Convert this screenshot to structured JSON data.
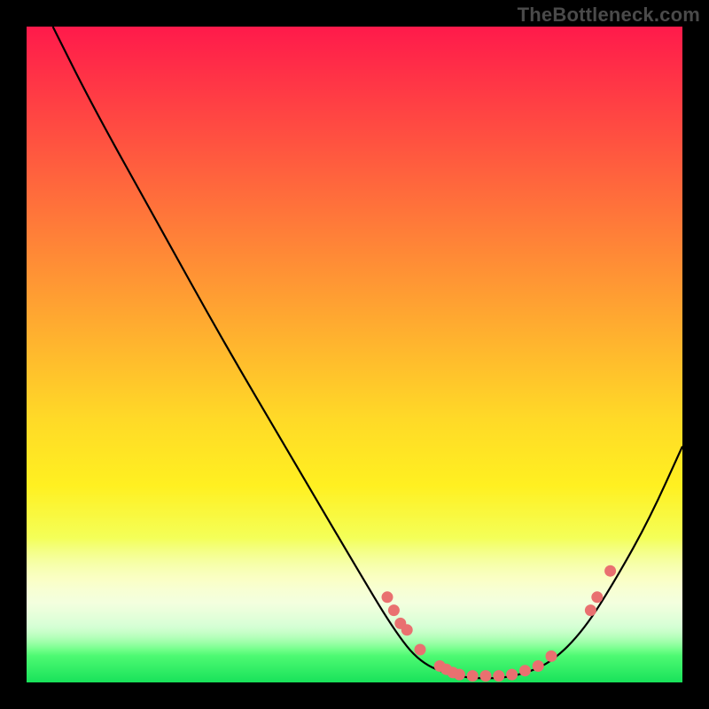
{
  "watermark": "TheBottleneck.com",
  "colors": {
    "background": "#000000",
    "gradient_top": "#ff1a4b",
    "gradient_mid": "#ffda27",
    "gradient_bottom": "#18e25a",
    "curve_stroke": "#000000",
    "dot_fill": "#e97070"
  },
  "chart_data": {
    "type": "line",
    "title": "",
    "xlabel": "",
    "ylabel": "",
    "xlim": [
      0,
      100
    ],
    "ylim": [
      0,
      100
    ],
    "note": "Axes are unlabeled; values are percent estimates along each axis read from pixel positions.",
    "series": [
      {
        "name": "bottleneck-curve",
        "points": [
          {
            "x": 4,
            "y": 100
          },
          {
            "x": 10,
            "y": 88
          },
          {
            "x": 20,
            "y": 70
          },
          {
            "x": 30,
            "y": 52
          },
          {
            "x": 40,
            "y": 35
          },
          {
            "x": 50,
            "y": 18
          },
          {
            "x": 56,
            "y": 8
          },
          {
            "x": 60,
            "y": 3
          },
          {
            "x": 65,
            "y": 1
          },
          {
            "x": 70,
            "y": 0.5
          },
          {
            "x": 75,
            "y": 1
          },
          {
            "x": 80,
            "y": 3
          },
          {
            "x": 85,
            "y": 8
          },
          {
            "x": 90,
            "y": 16
          },
          {
            "x": 95,
            "y": 25
          },
          {
            "x": 100,
            "y": 36
          }
        ]
      },
      {
        "name": "highlighted-dots",
        "points": [
          {
            "x": 55,
            "y": 13
          },
          {
            "x": 56,
            "y": 11
          },
          {
            "x": 57,
            "y": 9
          },
          {
            "x": 58,
            "y": 8
          },
          {
            "x": 60,
            "y": 5
          },
          {
            "x": 63,
            "y": 2.5
          },
          {
            "x": 64,
            "y": 2
          },
          {
            "x": 65,
            "y": 1.5
          },
          {
            "x": 66,
            "y": 1.2
          },
          {
            "x": 68,
            "y": 1
          },
          {
            "x": 70,
            "y": 1
          },
          {
            "x": 72,
            "y": 1
          },
          {
            "x": 74,
            "y": 1.2
          },
          {
            "x": 76,
            "y": 1.8
          },
          {
            "x": 78,
            "y": 2.5
          },
          {
            "x": 80,
            "y": 4
          },
          {
            "x": 86,
            "y": 11
          },
          {
            "x": 87,
            "y": 13
          },
          {
            "x": 89,
            "y": 17
          }
        ]
      }
    ]
  }
}
